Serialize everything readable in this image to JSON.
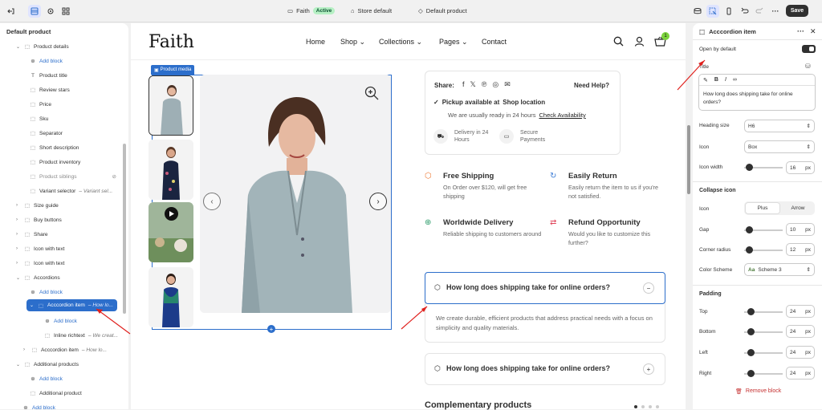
{
  "topbar": {
    "store_name": "Faith",
    "status": "Active",
    "theme_label": "Store default",
    "template_label": "Default product",
    "save_label": "Save"
  },
  "left_panel": {
    "title": "Default product",
    "items": [
      {
        "label": "Product details",
        "kind": "section"
      },
      {
        "label": "Add block",
        "kind": "add"
      },
      {
        "label": "Product title"
      },
      {
        "label": "Review stars"
      },
      {
        "label": "Price"
      },
      {
        "label": "Sku"
      },
      {
        "label": "Separator"
      },
      {
        "label": "Short description"
      },
      {
        "label": "Product inventory"
      },
      {
        "label": "Product siblings"
      },
      {
        "label": "Variant selector",
        "sub": "– Variant sel..."
      },
      {
        "label": "Size guide"
      },
      {
        "label": "Buy buttons"
      },
      {
        "label": "Share"
      },
      {
        "label": "Icon with text"
      },
      {
        "label": "Icon with text"
      },
      {
        "label": "Accordions"
      },
      {
        "label": "Add block",
        "kind": "add"
      },
      {
        "label": "Acccordion item",
        "sub": "– How lo..."
      },
      {
        "label": "Add block",
        "kind": "add"
      },
      {
        "label": "Inline richtext",
        "sub": "– We creat..."
      },
      {
        "label": "Acccordion item",
        "sub": "– How lo..."
      },
      {
        "label": "Additional products"
      },
      {
        "label": "Add block",
        "kind": "add"
      },
      {
        "label": "Additional product"
      },
      {
        "label": "Add block",
        "kind": "add"
      }
    ]
  },
  "store": {
    "logo": "Faith",
    "nav": [
      "Home",
      "Shop",
      "Collections",
      "Pages",
      "Contact"
    ],
    "cart_count": "1",
    "media_tag": "Product media",
    "share_label": "Share:",
    "need_help": "Need Help?",
    "pickup_title": "Pickup available at",
    "pickup_location": "Shop location",
    "pickup_sub": "We are usually ready in 24 hours",
    "check_link": "Check Availability",
    "delivery": "Delivery in 24 Hours",
    "secure": "Secure Payments",
    "features": [
      {
        "title": "Free Shipping",
        "desc": "On Order over $120, will get free shipping"
      },
      {
        "title": "Easily Return",
        "desc": "Easily return the item to us if you're not satisfied."
      },
      {
        "title": "Worldwide Delivery",
        "desc": "Reliable shipping to customers around"
      },
      {
        "title": "Refund Opportunity",
        "desc": "Would you like to customize this further?"
      }
    ],
    "accordion_q": "How long does shipping take for online orders?",
    "accordion_a": "We create durable, efficient products that address practical needs with a focus on simplicity and quality materials.",
    "accordion_q2": "How long does shipping take for online orders?",
    "complementary": "Complementary products"
  },
  "right_panel": {
    "title": "Acccordion item",
    "open_by_default": "Open by default",
    "title_label": "Title",
    "title_value": "How long does shipping take for online orders?",
    "heading_size_label": "Heading size",
    "heading_size": "H6",
    "icon_label": "Icon",
    "icon_value": "Box",
    "icon_width_label": "Icon width",
    "icon_width": "16",
    "collapse_icon_label": "Collapse icon",
    "collapse_icon_row_label": "Icon",
    "collapse_plus": "Plus",
    "collapse_arrow": "Arrow",
    "gap_label": "Gap",
    "gap": "10",
    "corner_label": "Corner radius",
    "corner": "12",
    "scheme_label": "Color Scheme",
    "scheme_value": "Scheme 3",
    "padding_label": "Padding",
    "top_label": "Top",
    "top": "24",
    "bottom_label": "Bottom",
    "bottom": "24",
    "left_label": "Left",
    "left": "24",
    "right_label": "Right",
    "right": "24",
    "px": "px",
    "remove": "Remove block"
  }
}
